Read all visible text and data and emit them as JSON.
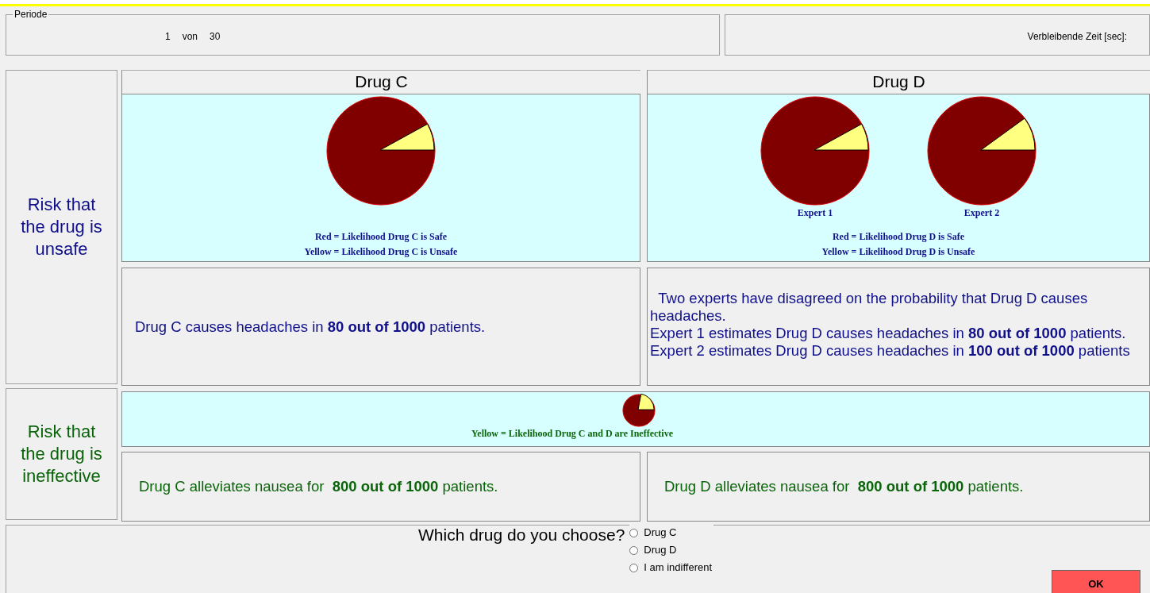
{
  "period": {
    "legend": "Periode",
    "current": "1",
    "separator": "von",
    "total": "30"
  },
  "timer": {
    "label": "Verbleibende Zeit [sec]:"
  },
  "rows": [
    {
      "label": "Risk that the drug is unsafe",
      "kind": "unsafe"
    },
    {
      "label": "Risk that the drug is ineffective",
      "kind": "ineffective"
    }
  ],
  "drugs": [
    {
      "title": "Drug C",
      "legend": [
        "Red = Likelihood Drug C is Safe",
        "Yellow = Likelihood Drug C is Unsafe"
      ],
      "unsafe_text": [
        "Drug C causes headaches in **80 out of 1000** patients."
      ],
      "ineffective_text": "Drug C alleviates nausea for  **800 out of 1000** patients."
    },
    {
      "title": "Drug D",
      "chart_labels": [
        "Expert 1",
        "Expert 2"
      ],
      "legend": [
        "Red = Likelihood Drug D is Safe",
        "Yellow = Likelihood Drug D is Unsafe"
      ],
      "unsafe_text": [
        "  Two experts have disagreed on the probability that Drug D causes headaches.",
        "Expert 1 estimates Drug D causes headaches in **80 out of 1000** patients.",
        "Expert 2 estimates Drug D causes headaches in **100 out of 1000** patients"
      ],
      "ineffective_text": "Drug D alleviates nausea for  **800 out of 1000** patients."
    }
  ],
  "ineffective_legend": "Yellow = Likelihood Drug C and D are Ineffective",
  "question": "Which drug do you choose?",
  "options": [
    {
      "label": "Drug C",
      "selected": false
    },
    {
      "label": "Drug D",
      "selected": false
    },
    {
      "label": "I am indifferent",
      "selected": false
    }
  ],
  "ok_button": "OK"
}
